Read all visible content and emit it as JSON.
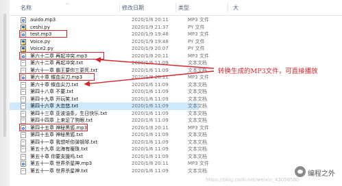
{
  "header": {
    "name": "名称",
    "date": "修改日期",
    "type": "类型",
    "size_cut": "大"
  },
  "files": [
    {
      "name": "auido.mp3",
      "date": "2020/1/8 20:11",
      "type": "MP3 文件",
      "icon": "mp3-file-icon"
    },
    {
      "name": "ceshi.py",
      "date": "2020/1/9 21:37",
      "type": "PY 文件",
      "icon": "python-file-icon"
    },
    {
      "name": "test.mp3",
      "date": "2020/1/9 19:48",
      "type": "MP3 文件",
      "icon": "mp3-file-icon",
      "highlight": true
    },
    {
      "name": "Voice.py",
      "date": "2020/1/9 19:48",
      "type": "PY 文件",
      "icon": "python-file-icon"
    },
    {
      "name": "Voice2.py",
      "date": "2020/1/9 20:07",
      "type": "PY 文件",
      "icon": "python-file-icon"
    },
    {
      "name": "第六十二章 再起冲突.mp3",
      "date": "2020/1/8 20:11",
      "type": "MP3 文件",
      "icon": "mp3-file-icon",
      "highlight": true
    },
    {
      "name": "第六十二章 再起冲突.txt",
      "date": "2020/1/6 11:09",
      "type": "文本文档",
      "icon": "text-file-icon"
    },
    {
      "name": "第六十一章 霸王要你三更死.txt",
      "date": "2020/1/6 11:09",
      "type": "文本文档",
      "icon": "text-file-icon"
    },
    {
      "name": "第六十章 蝶血尖刀.mp3",
      "date": "2020/1/8 20:11",
      "type": "MP3 文件",
      "icon": "mp3-file-icon",
      "highlight": true
    },
    {
      "name": "第六十章 蝶血尖刀.txt",
      "date": "2020/1/6 11:09",
      "type": "文本文档",
      "icon": "text-file-icon"
    },
    {
      "name": "第四十八章 不要.txt",
      "date": "2020/1/6 11:09",
      "type": "文本文档",
      "icon": "text-file-icon"
    },
    {
      "name": "第四十九章 开玩笑.txt",
      "date": "2020/1/6 11:09",
      "type": "文本文档",
      "icon": "text-file-icon"
    },
    {
      "name": "第四十六章 大忽悠.txt",
      "date": "2020/1/6 11:09",
      "type": "文本文档",
      "icon": "text-file-icon",
      "selected": true
    },
    {
      "name": "第四十三章 亚波油条，生日快乐.txt",
      "date": "2020/1/6 11:09",
      "type": "文本文档",
      "icon": "text-file-icon"
    },
    {
      "name": "第四十四章 上来足了狗眼.txt",
      "date": "2020/1/6 11:09",
      "type": "文本文档",
      "icon": "text-file-icon"
    },
    {
      "name": "第四十五章 神秘黑狐.mp3",
      "date": "2020/1/8 20:11",
      "type": "MP3 文件",
      "icon": "mp3-file-icon",
      "highlight": true
    },
    {
      "name": "第四十五章 神秘黑狐.txt",
      "date": "2020/1/6 11:09",
      "type": "文本文档",
      "icon": "text-file-icon"
    },
    {
      "name": "第四十一章 我想听你弹钢琴.txt",
      "date": "2020/1/6 11:09",
      "type": "文本文档",
      "icon": "text-file-icon"
    },
    {
      "name": "第五十九章 北海有暖珠.txt",
      "date": "2020/1/6 11:09",
      "type": "文本文档",
      "icon": "text-file-icon"
    },
    {
      "name": "第五十章 你要支援吗.txt",
      "date": "2020/1/6 11:09",
      "type": "文本文档",
      "icon": "text-file-icon"
    },
    {
      "name": "第五十一章 世界杀星神.mp3",
      "date": "2020/1/8 20:11",
      "type": "MP3 文件",
      "icon": "mp3-file-icon"
    },
    {
      "name": "第五十一章 世界杀星神.txt",
      "date": "2020/1/6 11:09",
      "type": "文本文档",
      "icon": "text-file-icon"
    }
  ],
  "annotation": "转换生成的MP3文件，可直接播放",
  "watermark": {
    "brand": "编程之外",
    "faint": "https://blog.csdn.net/weixin_43056580"
  },
  "colors": {
    "highlight_box": "#d8232a",
    "selection": "#cde8ff"
  }
}
